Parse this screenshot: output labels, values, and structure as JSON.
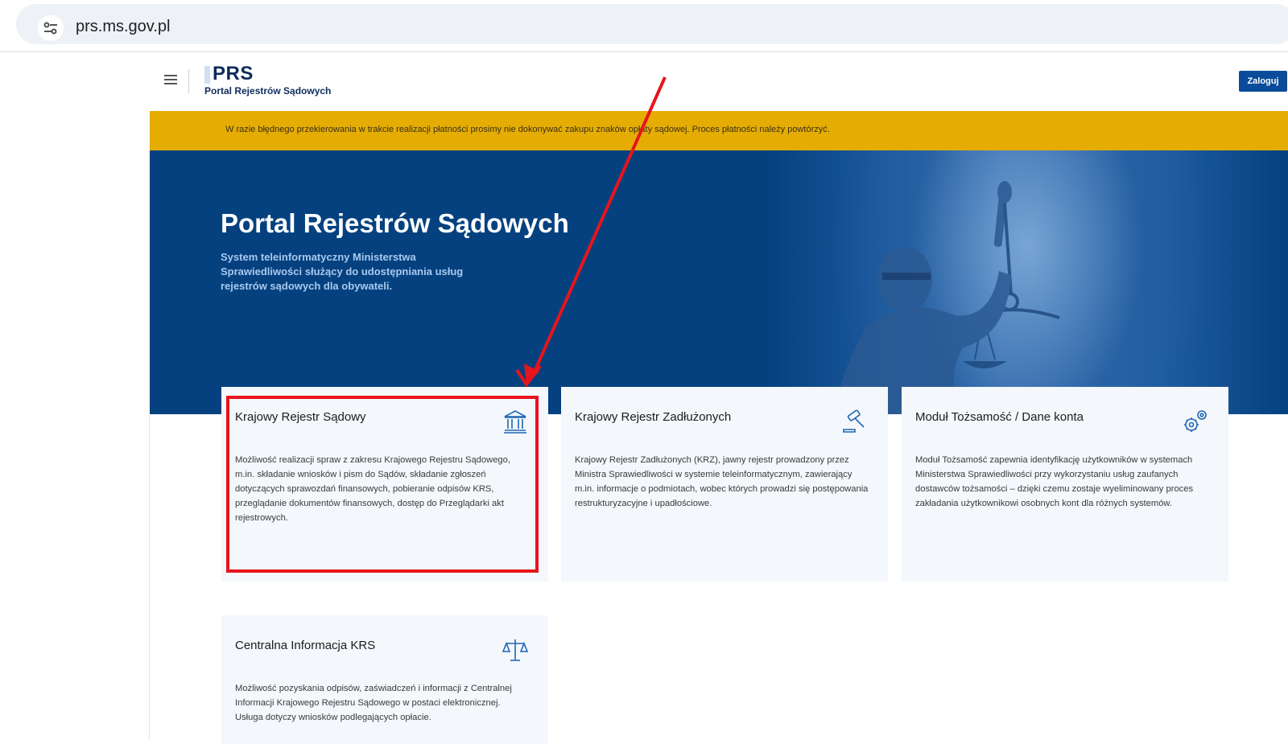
{
  "browser": {
    "url": "prs.ms.gov.pl"
  },
  "header": {
    "logo_title": "PRS",
    "logo_subtitle": "Portal Rejestrów Sądowych",
    "login_label": "Zaloguj"
  },
  "notice": {
    "text": "W razie błędnego przekierowania w trakcie realizacji płatności prosimy nie dokonywać zakupu znaków opłaty sądowej. Proces płatności należy powtórzyć.",
    "color": "#e5ad04"
  },
  "hero": {
    "title": "Portal Rejestrów Sądowych",
    "description": "System teleinformatyczny Ministerstwa Sprawiedliwości służący do udostępniania usług rejestrów sądowych dla obywateli.",
    "background_color": "#05417f"
  },
  "cards": [
    {
      "title": "Krajowy Rejestr Sądowy",
      "icon": "courthouse-icon",
      "description": "Możliwość realizacji spraw z zakresu Krajowego Rejestru Sądowego, m.in. składanie wniosków i pism do Sądów, składanie zgłoszeń dotyczących sprawozdań finansowych, pobieranie odpisów KRS, przeglądanie dokumentów finansowych, dostęp do Przeglądarki akt rejestrowych."
    },
    {
      "title": "Krajowy Rejestr Zadłużonych",
      "icon": "gavel-icon",
      "description": "Krajowy Rejestr Zadłużonych (KRZ), jawny rejestr prowadzony przez Ministra Sprawiedliwości w systemie teleinformatycznym, zawierający m.in. informacje o podmiotach, wobec których prowadzi się postępowania restrukturyzacyjne i upadłościowe."
    },
    {
      "title": "Moduł Tożsamość / Dane konta",
      "icon": "gears-icon",
      "description": "Moduł Tożsamość zapewnia identyfikację użytkowników w systemach Ministerstwa Sprawiedliwości przy wykorzystaniu usług zaufanych dostawców tożsamości – dzięki czemu zostaje wyeliminowany proces zakładania użytkownikowi osobnych kont dla różnych systemów."
    },
    {
      "title": "Centralna Informacja KRS",
      "icon": "scales-icon",
      "description": "Możliwość pozyskania odpisów, zaświadczeń i informacji z Centralnej Informacji Krajowego Rejestru Sądowego w postaci elektronicznej. Usługa dotyczy wniosków podlegających opłacie."
    }
  ],
  "annotation": {
    "color": "#e8141c"
  }
}
